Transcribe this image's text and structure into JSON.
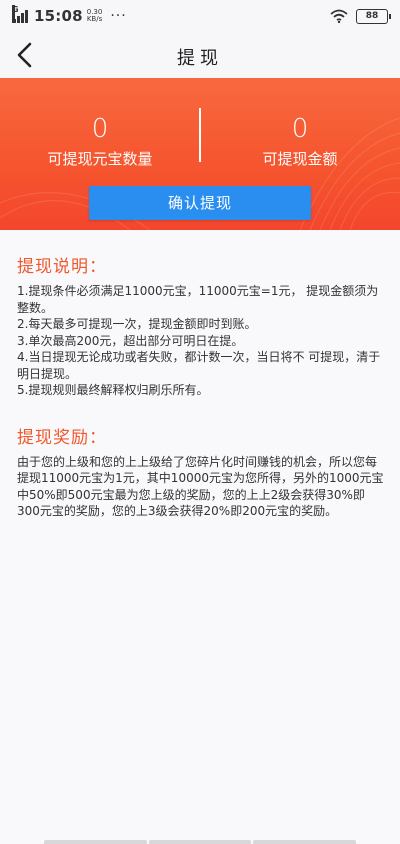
{
  "status_bar": {
    "time": "15:08",
    "speed_value": "0.30",
    "speed_unit": "KB/s",
    "more": "···",
    "battery": "88"
  },
  "nav": {
    "title": "提现"
  },
  "banner": {
    "ingot_count_value": "0",
    "ingot_count_label": "可提现元宝数量",
    "amount_value": "0",
    "amount_label": "可提现金额",
    "confirm_label": "确认提现"
  },
  "rules": {
    "title": "提现说明：",
    "lines": [
      "1.提现条件必须满足11000元宝，11000元宝=1元， 提现金额须为整数。",
      "2.每天最多可提现一次，提现金额即时到账。",
      "3.单次最高200元，超出部分可明日在提。",
      "4.当日提现无论成功或者失败，都计数一次，当日将不 可提现，清于明日提现。",
      "5.提现规则最终解释权归刷乐所有。"
    ]
  },
  "rewards": {
    "title": "提现奖励：",
    "text": "由于您的上级和您的上上级给了您碎片化时间赚钱的机会，所以您每提现11000元宝为1元，其中10000元宝为您所得，另外的1000元宝中50%即500元宝最为您上级的奖励，您的上上2级会获得30%即300元宝的奖励，您的上3级会获得20%即200元宝的奖励。"
  },
  "colors": {
    "banner_top": "#f8693f",
    "banner_bottom": "#f4462c",
    "button": "#2a8ef0",
    "section_title": "#f0582d"
  }
}
